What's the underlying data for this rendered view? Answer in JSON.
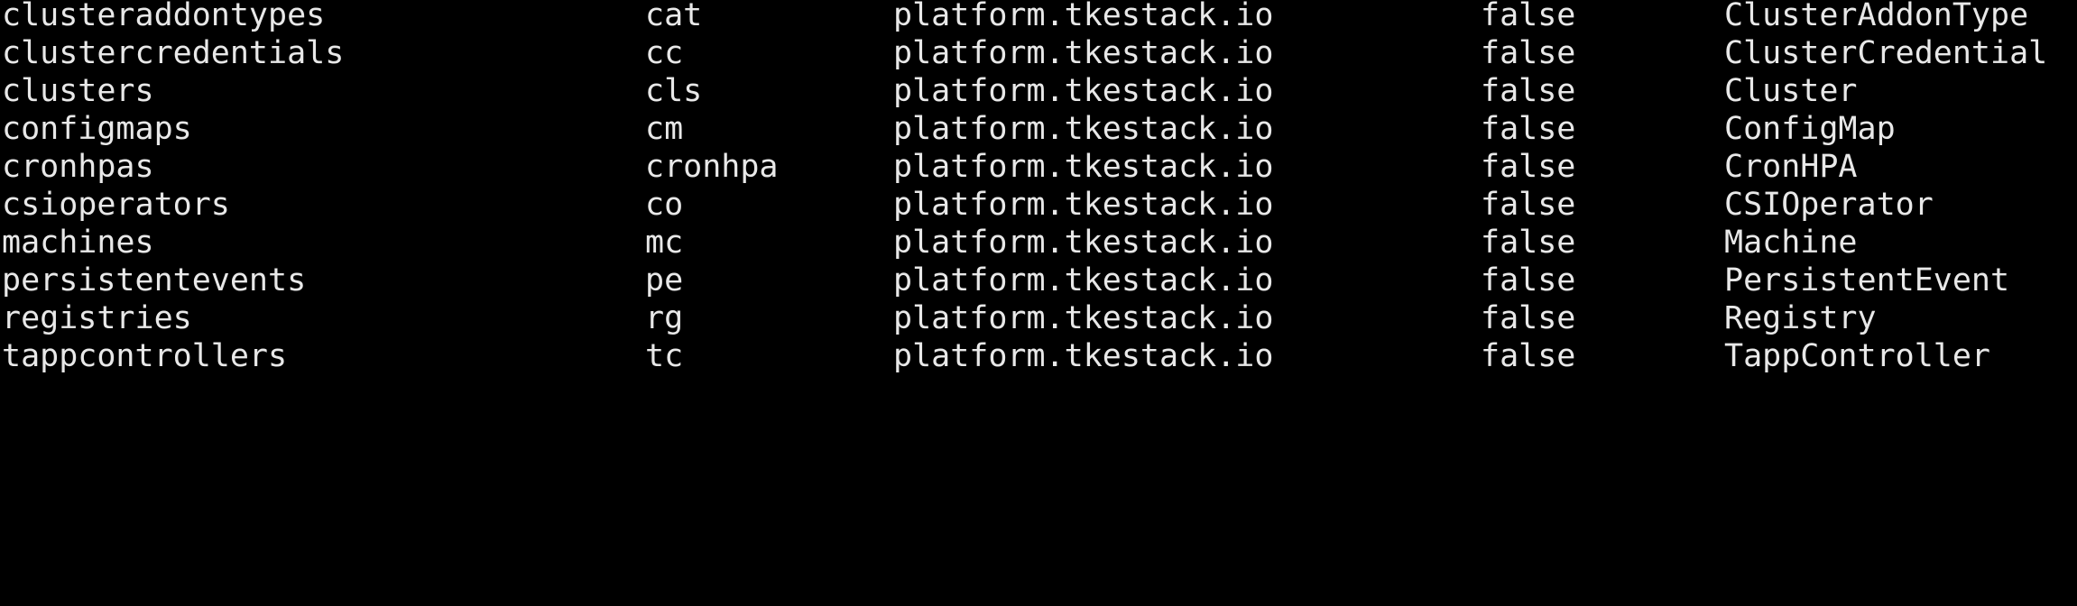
{
  "terminal": {
    "rows": [
      {
        "name": "clusteraddontypes",
        "shortname": "cat",
        "apigroup": "platform.tkestack.io",
        "namespaced": "false",
        "kind": "ClusterAddonType"
      },
      {
        "name": "clustercredentials",
        "shortname": "cc",
        "apigroup": "platform.tkestack.io",
        "namespaced": "false",
        "kind": "ClusterCredential"
      },
      {
        "name": "clusters",
        "shortname": "cls",
        "apigroup": "platform.tkestack.io",
        "namespaced": "false",
        "kind": "Cluster"
      },
      {
        "name": "configmaps",
        "shortname": "cm",
        "apigroup": "platform.tkestack.io",
        "namespaced": "false",
        "kind": "ConfigMap"
      },
      {
        "name": "cronhpas",
        "shortname": "cronhpa",
        "apigroup": "platform.tkestack.io",
        "namespaced": "false",
        "kind": "CronHPA"
      },
      {
        "name": "csioperators",
        "shortname": "co",
        "apigroup": "platform.tkestack.io",
        "namespaced": "false",
        "kind": "CSIOperator"
      },
      {
        "name": "machines",
        "shortname": "mc",
        "apigroup": "platform.tkestack.io",
        "namespaced": "false",
        "kind": "Machine"
      },
      {
        "name": "persistentevents",
        "shortname": "pe",
        "apigroup": "platform.tkestack.io",
        "namespaced": "false",
        "kind": "PersistentEvent"
      },
      {
        "name": "registries",
        "shortname": "rg",
        "apigroup": "platform.tkestack.io",
        "namespaced": "false",
        "kind": "Registry"
      },
      {
        "name": "tappcontrollers",
        "shortname": "tc",
        "apigroup": "platform.tkestack.io",
        "namespaced": "false",
        "kind": "TappController"
      }
    ]
  }
}
